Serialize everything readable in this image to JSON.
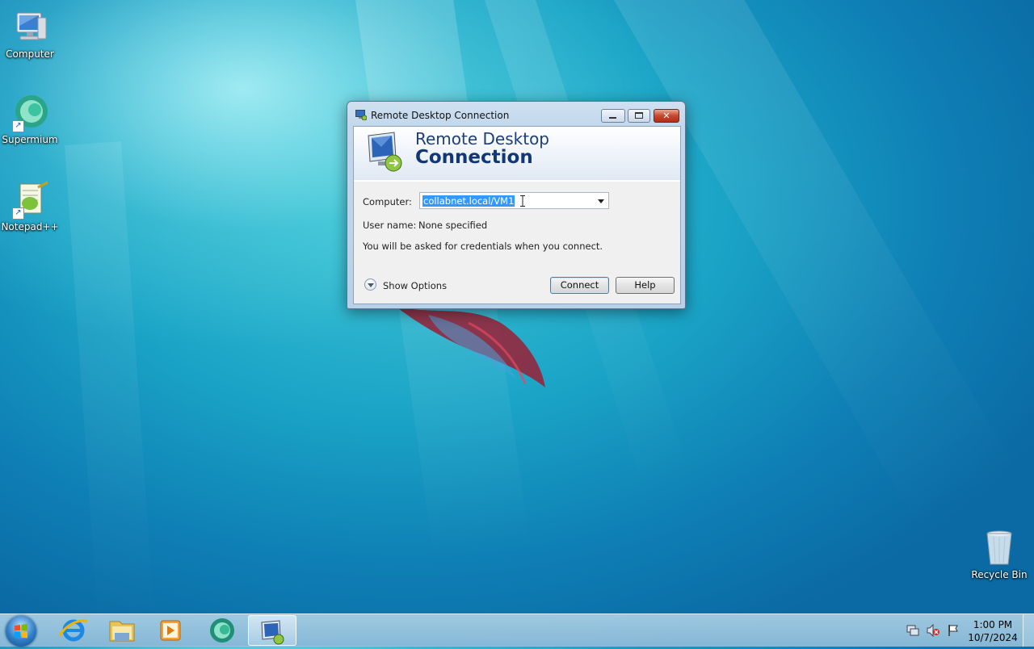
{
  "desktop": {
    "icons": [
      {
        "label": "Computer"
      },
      {
        "label": "Supermium"
      },
      {
        "label": "Notepad++"
      },
      {
        "label": "Recycle Bin"
      }
    ]
  },
  "dialog": {
    "title": "Remote Desktop Connection",
    "banner_line1": "Remote Desktop",
    "banner_line2": "Connection",
    "computer_label": "Computer:",
    "computer_value": "collabnet.local/VM1",
    "username_label": "User name:",
    "username_value": "None specified",
    "credentials_note": "You will be asked for credentials when you connect.",
    "show_options_label": "Show Options",
    "connect_label": "Connect",
    "help_label": "Help",
    "close_glyph": "✕"
  },
  "taskbar": {
    "clock_time": "1:00 PM",
    "clock_date": "10/7/2024",
    "pinned": [
      "internet-explorer",
      "file-explorer",
      "media-player",
      "supermium",
      "remote-desktop"
    ]
  }
}
